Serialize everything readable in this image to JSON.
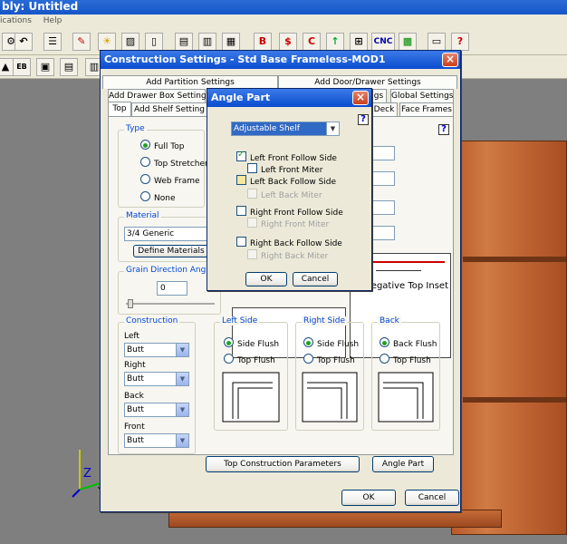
{
  "app": {
    "title": "bly: Untitled",
    "menu": [
      "ications",
      "Help"
    ]
  },
  "toolbar": {
    "cnc_label": "CNC",
    "help_label": "?"
  },
  "construction_dialog": {
    "title": "Construction Settings - Std Base Frameless-MOD1",
    "close": "×",
    "tabs_row1": [
      "Add Partition Settings",
      "Add Door/Drawer Settings"
    ],
    "tabs_row2": [
      "Add Drawer Box Settings",
      "gs",
      "Global Settings"
    ],
    "tabs_row3": [
      "Top",
      "Add Shelf Setting",
      "Deck",
      "Face Frames"
    ],
    "help": "?",
    "type_group": {
      "label": "Type",
      "options": [
        "Full Top",
        "Top Stretcher",
        "Web Frame",
        "None"
      ],
      "selected": "Full Top"
    },
    "material_group": {
      "label": "Material",
      "value": "3/4 Generic",
      "define_button": "Define Materials"
    },
    "grain_group": {
      "label": "Grain Direction Angle",
      "value": "0"
    },
    "preview_text": "Negative Top Inset",
    "construction_group": {
      "label": "Construction",
      "fields": [
        {
          "label": "Left",
          "value": "Butt"
        },
        {
          "label": "Right",
          "value": "Butt"
        },
        {
          "label": "Back",
          "value": "Butt"
        },
        {
          "label": "Front",
          "value": "Butt"
        }
      ]
    },
    "left_side": {
      "label": "Left Side",
      "options": [
        "Side Flush",
        "Top Flush"
      ],
      "selected": "Side Flush"
    },
    "right_side": {
      "label": "Right Side",
      "options": [
        "Side Flush",
        "Top Flush"
      ],
      "selected": "Side Flush"
    },
    "back": {
      "label": "Back",
      "options": [
        "Back Flush",
        "Top Flush"
      ],
      "selected": "Back Flush"
    },
    "top_params_button": "Top Construction Parameters",
    "angle_part_button": "Angle Part",
    "ok": "OK",
    "cancel": "Cancel"
  },
  "angle_dialog": {
    "title": "Angle Part",
    "close": "×",
    "help": "?",
    "dropdown": "Adjustable Shelf",
    "checks": [
      {
        "label": "Left Front Follow Side",
        "checked": true,
        "disabled": false
      },
      {
        "label": "Left Front Miter",
        "checked": false,
        "disabled": false
      },
      {
        "label": "Left Back Follow Side",
        "checked": false,
        "disabled": false
      },
      {
        "label": "Left Back Miter",
        "checked": false,
        "disabled": true
      },
      {
        "label": "Right Front Follow Side",
        "checked": false,
        "disabled": false
      },
      {
        "label": "Right Front Miter",
        "checked": false,
        "disabled": true
      },
      {
        "label": "Right Back Follow Side",
        "checked": false,
        "disabled": false
      },
      {
        "label": "Right Back Miter",
        "checked": false,
        "disabled": true
      }
    ],
    "ok": "OK",
    "cancel": "Cancel"
  },
  "axes": {
    "z": "Z",
    "y": "Y"
  }
}
